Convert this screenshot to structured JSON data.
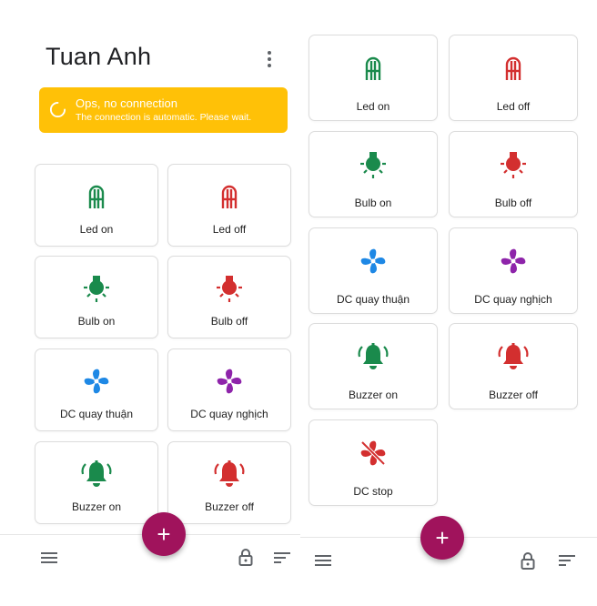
{
  "left_screen": {
    "title": "Tuan Anh",
    "banner": {
      "title": "Ops, no connection",
      "subtitle": "The connection is automatic. Please wait."
    },
    "cards": [
      {
        "label": "Led on",
        "icon": "led-icon",
        "color": "#1a8a4c"
      },
      {
        "label": "Led off",
        "icon": "led-icon",
        "color": "#d32f2f"
      },
      {
        "label": "Bulb on",
        "icon": "bulb-icon",
        "color": "#1a8a4c"
      },
      {
        "label": "Bulb off",
        "icon": "bulb-icon",
        "color": "#d32f2f"
      },
      {
        "label": "DC quay thuận",
        "icon": "fan-icon",
        "color": "#1e88e5"
      },
      {
        "label": "DC quay nghịch",
        "icon": "fan-icon",
        "color": "#8e24aa"
      },
      {
        "label": "Buzzer on",
        "icon": "bell-ringing-icon",
        "color": "#1a8a4c"
      },
      {
        "label": "Buzzer off",
        "icon": "bell-ringing-icon",
        "color": "#d32f2f"
      }
    ],
    "fab_label": "+"
  },
  "right_screen": {
    "cards": [
      {
        "label": "Led on",
        "icon": "led-icon",
        "color": "#1a8a4c"
      },
      {
        "label": "Led off",
        "icon": "led-icon",
        "color": "#d32f2f"
      },
      {
        "label": "Bulb on",
        "icon": "bulb-icon",
        "color": "#1a8a4c"
      },
      {
        "label": "Bulb off",
        "icon": "bulb-icon",
        "color": "#d32f2f"
      },
      {
        "label": "DC quay thuận",
        "icon": "fan-icon",
        "color": "#1e88e5"
      },
      {
        "label": "DC quay nghịch",
        "icon": "fan-icon",
        "color": "#8e24aa"
      },
      {
        "label": "Buzzer on",
        "icon": "bell-ringing-icon",
        "color": "#1a8a4c"
      },
      {
        "label": "Buzzer off",
        "icon": "bell-ringing-icon",
        "color": "#d32f2f"
      },
      {
        "label": "DC stop",
        "icon": "fan-off-icon",
        "color": "#d32f2f"
      }
    ],
    "fab_label": "+"
  },
  "theme": {
    "accent": "#a0135c",
    "warning": "#ffc107",
    "on_color": "#1a8a4c",
    "off_color": "#d32f2f"
  }
}
